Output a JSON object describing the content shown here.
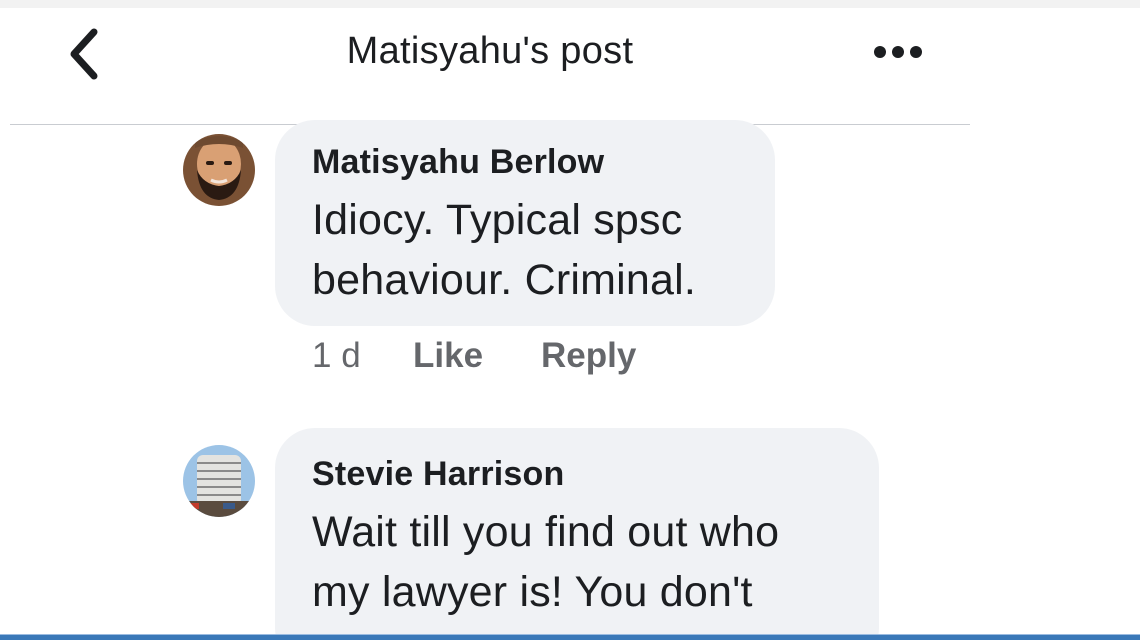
{
  "header": {
    "title": "Matisyahu's post",
    "back_icon": "chevron-left-icon",
    "more_icon": "more-horizontal-icon"
  },
  "comments": [
    {
      "author": "Matisyahu Berlow",
      "text_lines": [
        "Idiocy. Typical spsc",
        "behaviour. Criminal."
      ],
      "time": "1 d",
      "like_label": "Like",
      "reply_label": "Reply"
    },
    {
      "author": "Stevie Harrison",
      "text_lines": [
        "Wait till you find out who",
        "my lawyer is! You don't"
      ]
    }
  ],
  "colors": {
    "bubble": "#f0f2f5",
    "text": "#1c1e21",
    "meta": "#65676b",
    "divider": "#c9ccd1"
  }
}
